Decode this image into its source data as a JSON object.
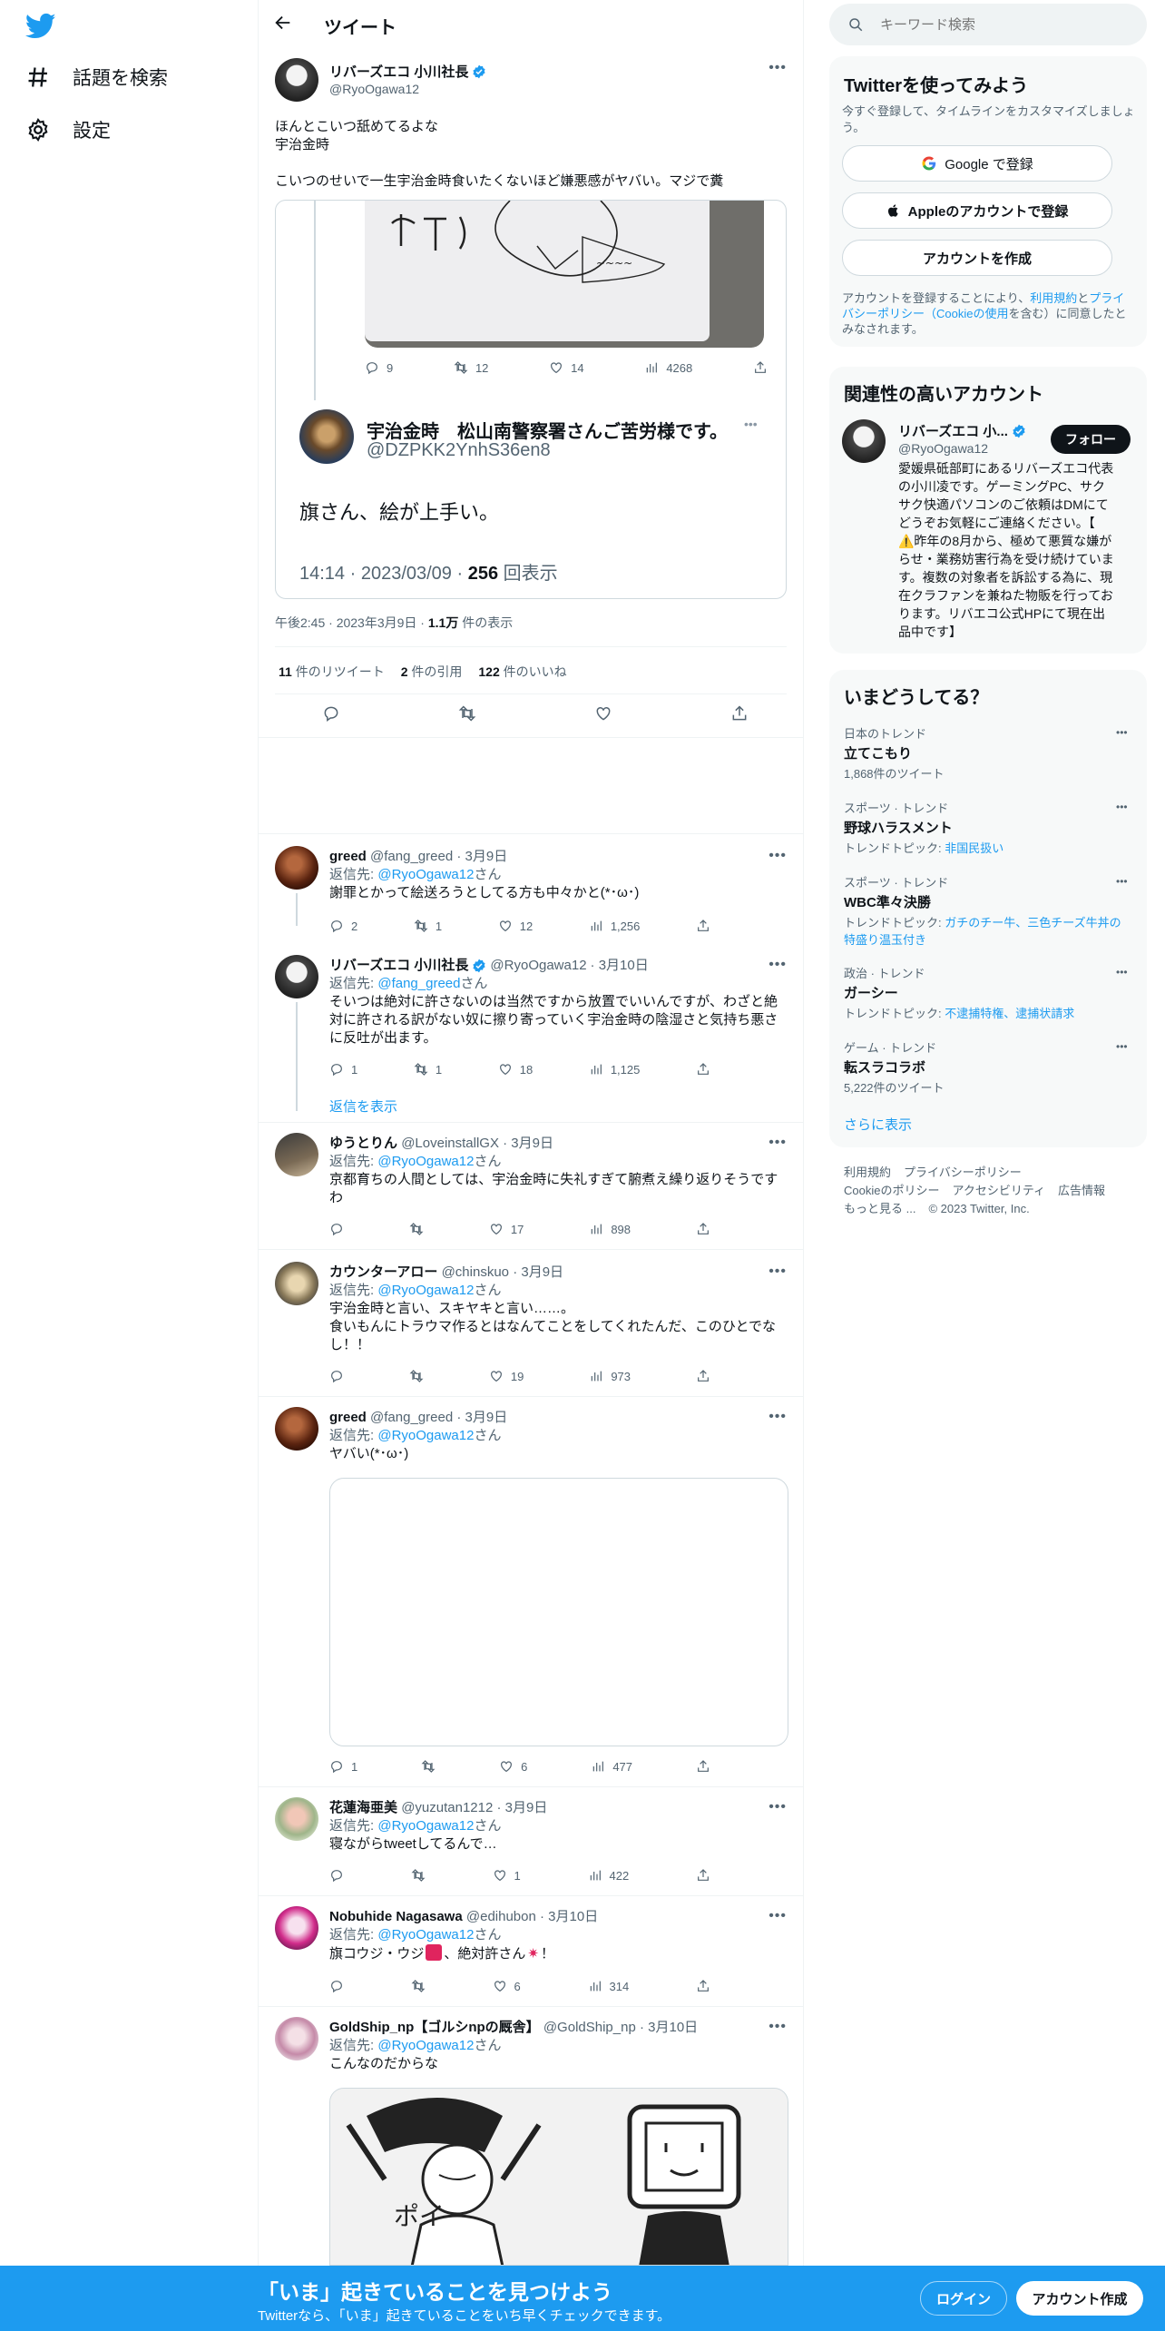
{
  "nav": {
    "explore": "話題を検索",
    "settings": "設定"
  },
  "header": {
    "title": "ツイート"
  },
  "main_tweet": {
    "name": "リバーズエコ 小川社長",
    "handle": "@RyoOgawa12",
    "text_line1": "ほんとこいつ舐めてるよな",
    "text_line2": "宇治金時",
    "text_line3": "こいつのせいで一生宇治金時食いたくないほど嫌悪感がヤバい。マジで糞",
    "quoted_stats": {
      "replies": "9",
      "retweets": "12",
      "likes": "14",
      "views": "4268"
    },
    "quoted": {
      "name": "宇治金時　松山南警察署さんご苦労様です。",
      "handle": "@DZPKK2YnhS36en8",
      "text": "旗さん、絵が上手い。",
      "meta_prefix": "14:14 · 2023/03/09 · ",
      "views_count": "256",
      "views_suffix": " 回表示"
    },
    "meta_prefix": "午後2:45 · 2023年3月9日 · ",
    "views_count": "1.1万",
    "views_suffix": " 件の表示",
    "retweet_count": "11",
    "retweet_label": " 件のリツイート",
    "quote_count": "2",
    "quote_label": " 件の引用",
    "like_count": "122",
    "like_label": " 件のいいね"
  },
  "reply_prefix": "返信先: ",
  "reply_suffix": "さん",
  "show_replies": "返信を表示",
  "replies": [
    {
      "name": "greed",
      "handle": "@fang_greed",
      "date": "· 3月9日",
      "to": "@RyoOgawa12",
      "text": "謝罪とかって絵送ろうとしてる方も中々かと(*･ω･)",
      "replies": "2",
      "retweets": "1",
      "likes": "12",
      "views": "1,256"
    },
    {
      "name": "リバーズエコ 小川社長",
      "handle": "@RyoOgawa12",
      "date": "· 3月10日",
      "to": "@fang_greed",
      "line1": "そいつは絶対に許さないのは当然ですから放置でいいんですが、わざと絶",
      "line2": "対に許される訳がない奴に擦り寄っていく宇治金時の陰湿さと気持ち悪さ",
      "line3": "に反吐が出ます。",
      "replies": "1",
      "retweets": "1",
      "likes": "18",
      "views": "1,125"
    },
    {
      "name": "ゆうとりん",
      "handle": "@LoveinstallGX",
      "date": "· 3月9日",
      "to": "@RyoOgawa12",
      "line1": "京都育ちの人間としては、宇治金時に失礼すぎて腑煮え繰り返りそうです",
      "line2": "わ",
      "likes": "17",
      "views": "898"
    },
    {
      "name": "カウンターアロー",
      "handle": "@chinskuo",
      "date": "· 3月9日",
      "to": "@RyoOgawa12",
      "line1": "宇治金時と言い、スキヤキと言い……。",
      "line2": "食いもんにトラウマ作るとはなんてことをしてくれたんだ、このひとでな",
      "line3": "し！！",
      "likes": "19",
      "views": "973"
    },
    {
      "name": "greed",
      "handle": "@fang_greed",
      "date": "· 3月9日",
      "to": "@RyoOgawa12",
      "text": "ヤバい(*･ω･)",
      "replies": "1",
      "likes": "6",
      "views": "477"
    },
    {
      "name": "花蓮海亜美",
      "handle": "@yuzutan1212",
      "date": "· 3月9日",
      "to": "@RyoOgawa12",
      "text": "寝ながらtweetしてるんで…",
      "likes": "1",
      "views": "422"
    },
    {
      "name": "Nobuhide Nagasawa",
      "handle": "@edihubon",
      "date": "· 3月10日",
      "to": "@RyoOgawa12",
      "text_a": "旗コウジ・ウジ",
      "text_b": "、絶対許さん",
      "text_c": "！",
      "likes": "6",
      "views": "314"
    },
    {
      "name": "GoldShip_np【ゴルシnpの厩舎】",
      "handle": "@GoldShip_np",
      "date": "· 3月10日",
      "to": "@RyoOgawa12",
      "text": "こんなのだからな"
    }
  ],
  "sidebar": {
    "search_placeholder": "キーワード検索",
    "signup": {
      "title": "Twitterを使ってみよう",
      "subtitle_line1": "今すぐ登録して、タイムラインをカスタマイズしましょ",
      "subtitle_line2": "う。",
      "google": "Google で登録",
      "apple": "Appleのアカウントで登録",
      "create": "アカウントを作成",
      "terms_a": "アカウントを登録することにより、",
      "terms_b": "利用規約",
      "terms_c": "と",
      "terms_d": "プライ",
      "terms_e": "バシーポリシー（Cookieの使用",
      "terms_f": "を含む）に同意したと",
      "terms_g": "みなされます。"
    },
    "related": {
      "title": "関連性の高いアカウント",
      "name": "リバーズエコ 小...",
      "handle": "@RyoOgawa12",
      "follow": "フォロー",
      "bio": [
        "愛媛県砥部町にあるリバーズエコ代表",
        "の小川凌です。ゲーミングPC、サク",
        "サク快適パソコンのご依頼はDMにて",
        "どうぞお気軽にご連絡ください。【",
        "⚠️昨年の8月から、極めて悪質な嫌が",
        "らせ・業務妨害行為を受け続けていま",
        "す。複数の対象者を訴訟する為に、現",
        "在クラファンを兼ねた物販を行ってお",
        "ります。リバエコ公式HPにて現在出",
        "品中です】"
      ]
    },
    "trends": {
      "title": "いまどうしてる？",
      "items": [
        {
          "cat": "日本のトレンド",
          "name": "立てこもり",
          "sub": "1,868件のツイート"
        },
        {
          "cat": "スポーツ · トレンド",
          "name": "野球ハラスメント",
          "sub_label": "トレンドトピック: ",
          "sub_link": "非国民扱い"
        },
        {
          "cat": "スポーツ · トレンド",
          "name": "WBC準々決勝",
          "sub_label": "トレンドトピック: ",
          "sub_link": "ガチのチー牛、三色チーズ牛丼の",
          "sub_link2": "特盛り温玉付き"
        },
        {
          "cat": "政治 · トレンド",
          "name": "ガーシー",
          "sub_label": "トレンドトピック: ",
          "sub_link": "不逮捕特権、逮捕状請求"
        },
        {
          "cat": "ゲーム · トレンド",
          "name": "転スラコラボ",
          "sub": "5,222件のツイート"
        }
      ],
      "more": "さらに表示"
    },
    "footer": {
      "row1": [
        "利用規約",
        "プライバシーポリシー"
      ],
      "row2": [
        "Cookieのポリシー",
        "アクセシビリティ",
        "広告情報"
      ],
      "more": "もっと見る ...",
      "copyright": "© 2023 Twitter, Inc."
    }
  },
  "banner": {
    "title": "「いま」起きていることを見つけよう",
    "subtitle": "Twitterなら、「いま」起きていることをいち早くチェックできます。",
    "login": "ログイン",
    "signup": "アカウント作成"
  },
  "colors": {
    "accent": "#1d9bf0",
    "text": "#0f1419",
    "muted": "#536471",
    "verified": "#1d9bf0"
  }
}
